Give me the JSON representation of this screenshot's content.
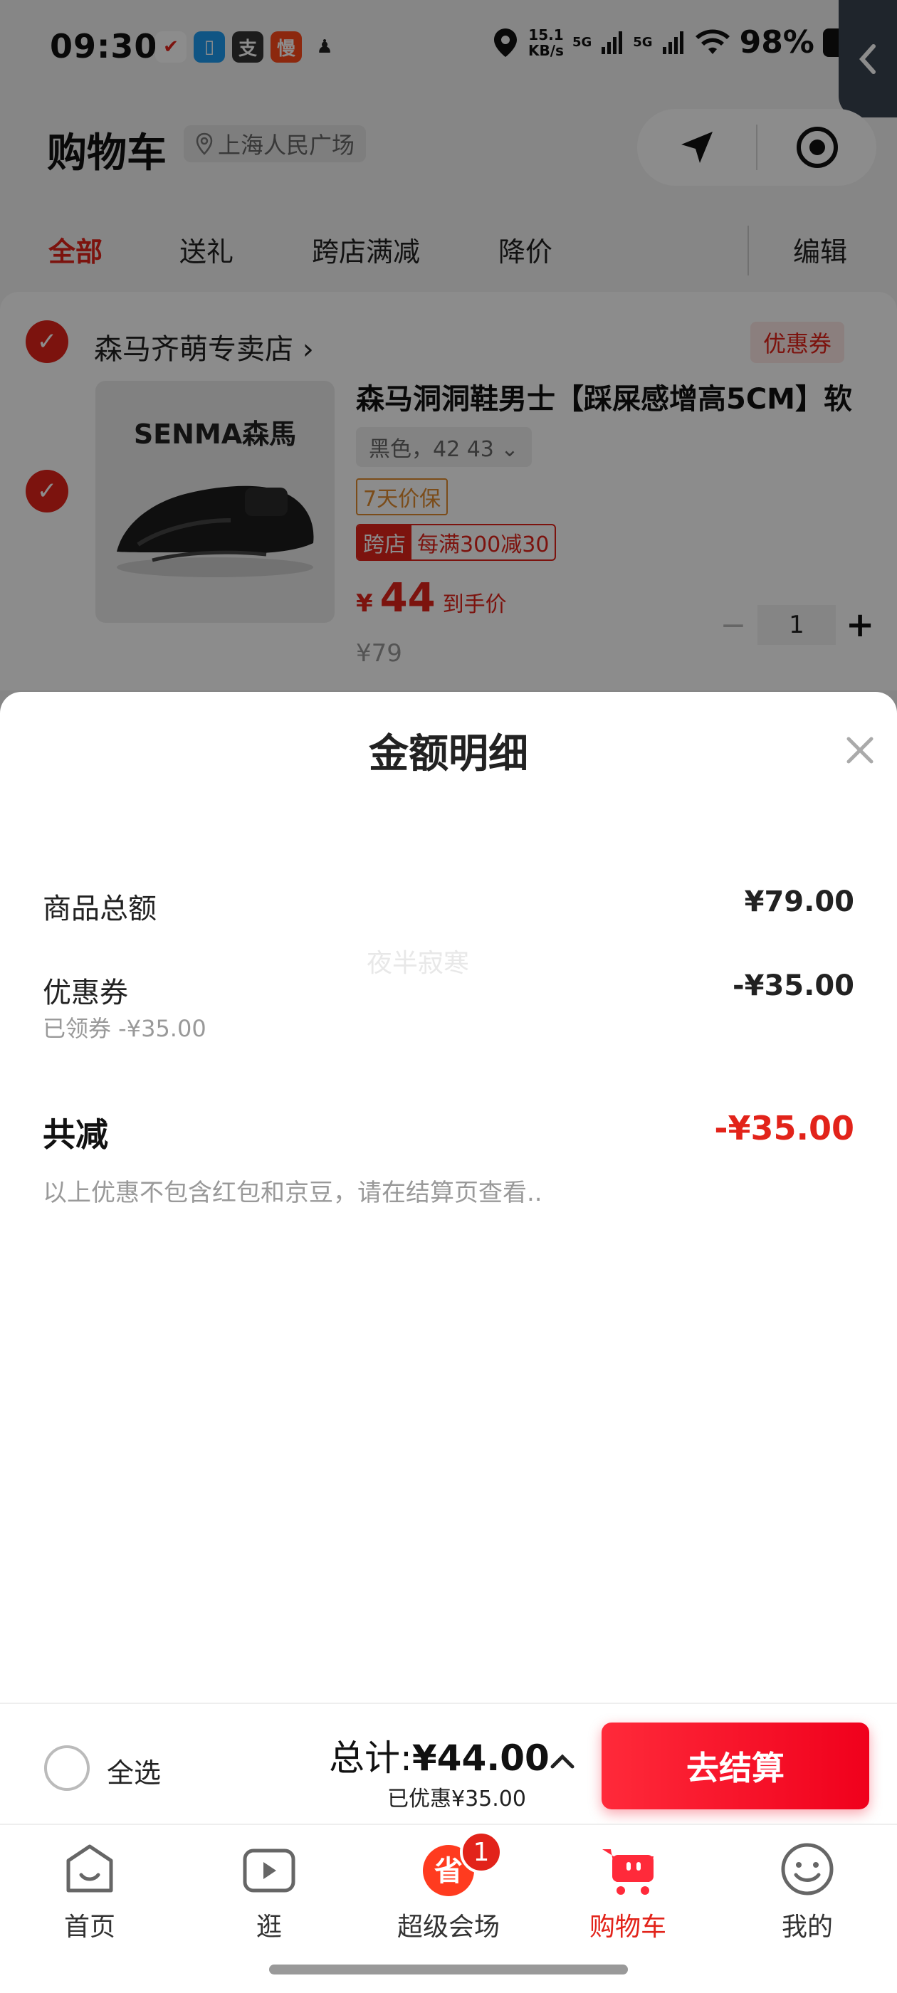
{
  "status_bar": {
    "time": "09:30",
    "net_speed_value": "15.1",
    "net_speed_unit": "KB/s",
    "signal_1": "5G",
    "signal_2": "5G",
    "battery": "98%"
  },
  "header": {
    "title": "购物车",
    "location": "上海人民广场"
  },
  "tabs": [
    "全部",
    "送礼",
    "跨店满减",
    "降价"
  ],
  "edit_label": "编辑",
  "store": {
    "name": "森马齐萌专卖店",
    "coupon_tag": "优惠券"
  },
  "product": {
    "brand": "SENMA森馬",
    "title": "森马洞洞鞋男士【踩屎感增高5CM】软",
    "spec": "黑色，42 43",
    "guarantee": "7天价保",
    "promo_tag": "跨店",
    "promo_text": "每满300减30",
    "price_currency": "¥",
    "price": "44",
    "price_note": "到手价",
    "original_price": "¥79",
    "quantity": "1"
  },
  "sheet": {
    "title": "金额明细",
    "watermark": "夜半寂寒",
    "rows": {
      "goods_total_label": "商品总额",
      "goods_total_value": "¥79.00",
      "coupon_label": "优惠券",
      "coupon_value": "-¥35.00",
      "coupon_sub": "已领券 -¥35.00"
    },
    "total_discount_label": "共减",
    "total_discount_value": "-¥35.00",
    "note": "以上优惠不包含红包和京豆，请在结算页查看.."
  },
  "checkout": {
    "select_all": "全选",
    "total_prefix": "总计:",
    "total_value": "¥44.00",
    "discount_text": "已优惠¥35.00",
    "pay_button": "去结算"
  },
  "nav": {
    "items": [
      "首页",
      "逛",
      "超级会场",
      "购物车",
      "我的"
    ],
    "badge": "1",
    "active_index": 3
  },
  "colors": {
    "accent": "#e2231a",
    "button_gradient_start": "#ff2a3a",
    "button_gradient_end": "#f0001c",
    "overlay": "rgba(0,0,0,0.45)"
  }
}
